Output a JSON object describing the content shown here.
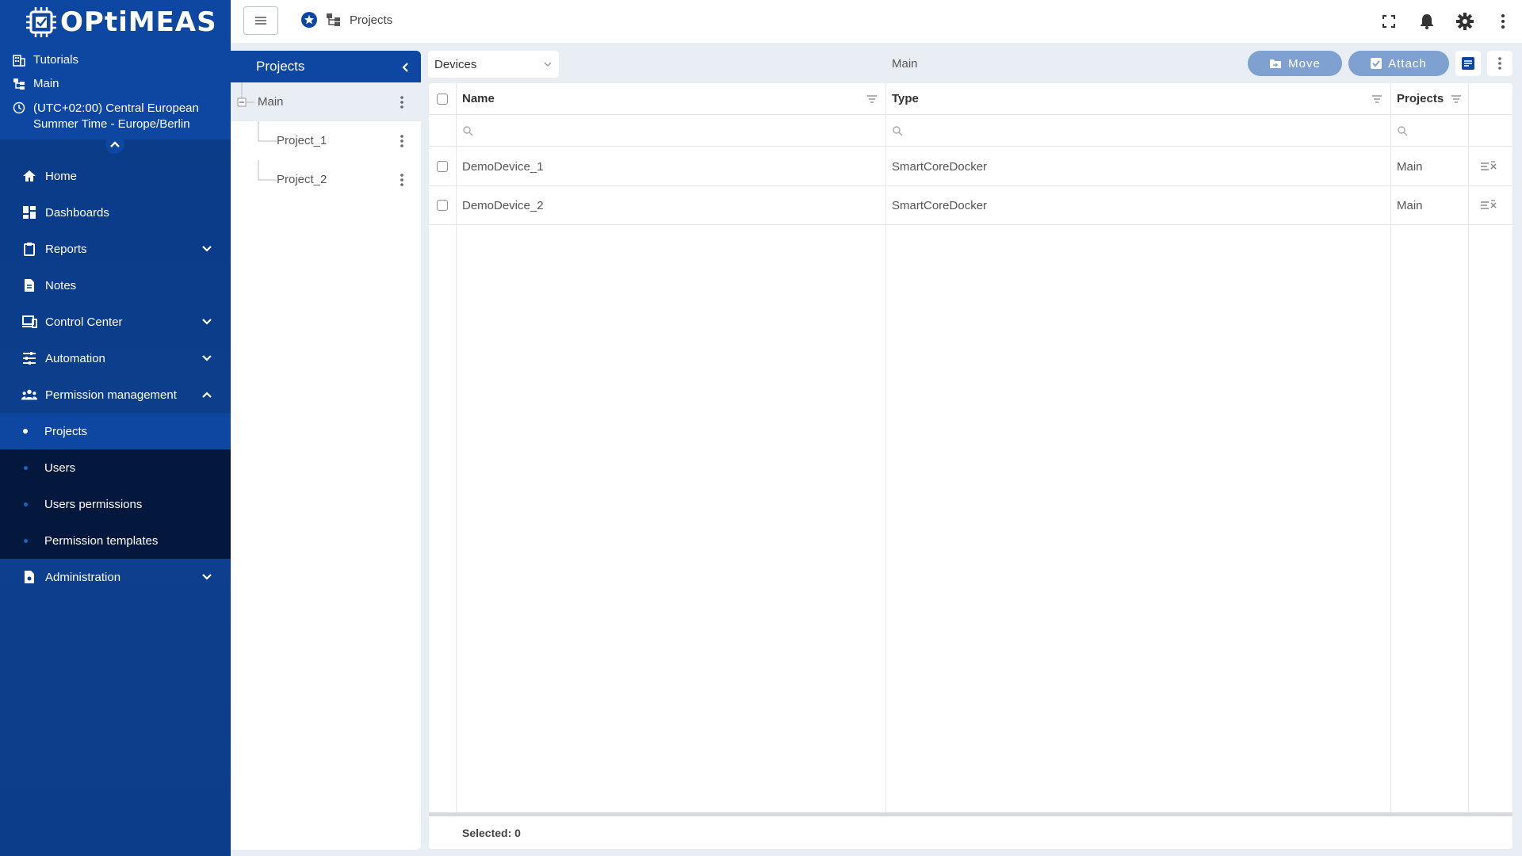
{
  "brand": {
    "name": "OPtiMEAS"
  },
  "sidebar": {
    "tutorials": "Tutorials",
    "project": "Main",
    "timezone_line1": "(UTC+02:00) Central European",
    "timezone_line2": "Summer Time - Europe/Berlin",
    "nav": {
      "home": "Home",
      "dashboards": "Dashboards",
      "reports": "Reports",
      "notes": "Notes",
      "control_center": "Control Center",
      "automation": "Automation",
      "permission_management": "Permission management",
      "administration": "Administration"
    },
    "sub": {
      "projects": "Projects",
      "users": "Users",
      "users_permissions": "Users permissions",
      "permission_templates": "Permission templates"
    }
  },
  "topbar": {
    "breadcrumb": "Projects"
  },
  "tree": {
    "title": "Projects",
    "items": [
      {
        "label": "Main"
      },
      {
        "label": "Project_1"
      },
      {
        "label": "Project_2"
      }
    ]
  },
  "toolbar": {
    "select_value": "Devices",
    "context": "Main",
    "move": "Move",
    "attach": "Attach"
  },
  "grid": {
    "columns": {
      "name": "Name",
      "type": "Type",
      "projects": "Projects"
    },
    "rows": [
      {
        "name": "DemoDevice_1",
        "type": "SmartCoreDocker",
        "projects": "Main"
      },
      {
        "name": "DemoDevice_2",
        "type": "SmartCoreDocker",
        "projects": "Main"
      }
    ],
    "footer": "Selected: 0"
  },
  "colors": {
    "primary": "#0d47a1",
    "sidebar_dark": "#04183d",
    "button_disabled": "#7ea1d1"
  }
}
